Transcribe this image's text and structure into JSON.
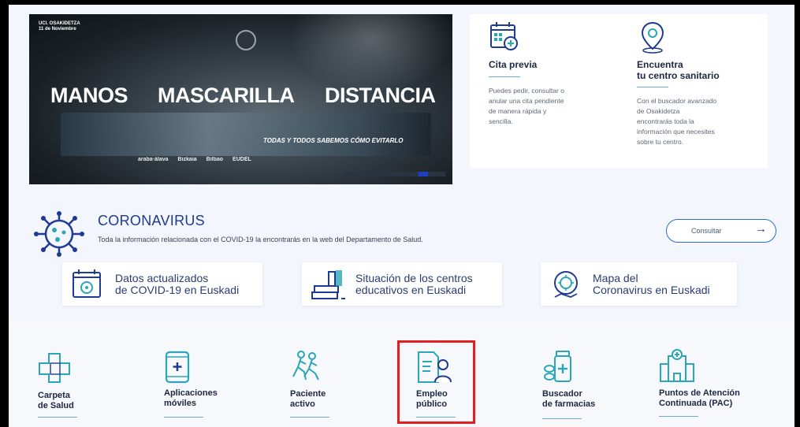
{
  "hero": {
    "date_text": "UCI. OSAKIDETZA\n11 de Noviembre",
    "words": [
      "MANOS",
      "MASCARILLA",
      "DISTANCIA"
    ],
    "tagline": "TODAS Y TODOS SABEMOS CÓMO EVITARLO",
    "logos": [
      "araba·álava",
      "Bizkaia",
      "Bilbao",
      "EUDEL"
    ]
  },
  "services": [
    {
      "title": "Cita previa",
      "icon": "calendar-medical-icon",
      "description": "Puedes pedir, consultar o\nanular una cita pendiente\nde manera rápida y\nsencilla."
    },
    {
      "title": "Encuentra\ntu centro sanitario",
      "icon": "map-pin-icon",
      "description": "Con el buscador avanzado\nde Osakidetza\nencontrarás toda la\ninformación que necesites\nsobre tu centro."
    }
  ],
  "coronavirus": {
    "title": "CORONAVIRUS",
    "description": "Toda la información relacionada con el COVID-19 la encontrarás en la web del Departamento de Salud.",
    "button_label": "Consultar",
    "button_arrow": "→",
    "cards": [
      {
        "label": "Datos actualizados\nde COVID-19 en Euskadi",
        "icon": "calendar-virus-icon"
      },
      {
        "label": "Situación de los centros\neducativos en Euskadi",
        "icon": "books-icon"
      },
      {
        "label": "Mapa del\nCoronavirus en Euskadi",
        "icon": "map-virus-icon"
      }
    ]
  },
  "quick_links": [
    {
      "label": "Carpeta\nde Salud",
      "icon": "health-folder-icon"
    },
    {
      "label": "Aplicaciones\nmóviles",
      "icon": "mobile-app-icon"
    },
    {
      "label": "Paciente\nactivo",
      "icon": "active-patient-icon"
    },
    {
      "label": "Empleo\npúblico",
      "icon": "public-employment-icon"
    },
    {
      "label": "Buscador\nde farmacias",
      "icon": "pharmacy-icon"
    },
    {
      "label": "Puntos de Atención\nContinuada (PAC)",
      "icon": "hospital-icon"
    }
  ],
  "colors": {
    "accent": "#1f3a93",
    "icon_teal": "#2aa6b8",
    "highlight": "#e02020"
  }
}
